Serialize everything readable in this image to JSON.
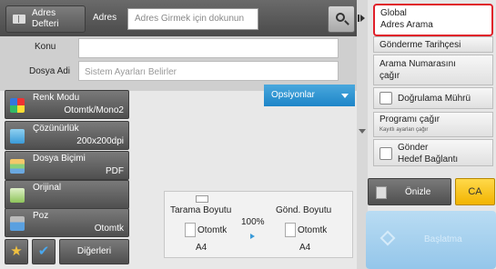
{
  "topbar": {
    "address_book_label": "Adres\nDefteri",
    "address_label": "Adres",
    "address_placeholder": "Adres Girmek için dokunun"
  },
  "form": {
    "subject_label": "Konu",
    "subject_value": "",
    "filename_label": "Dosya Adi",
    "filename_placeholder": "Sistem Ayarları Belirler",
    "options_label": "Opsiyonlar"
  },
  "settings": [
    {
      "title": "Renk Modu",
      "value": "Otomtk/Mono2",
      "icon": "color-mode-icon"
    },
    {
      "title": "Çözünürlük",
      "value": "200x200dpi",
      "icon": "resolution-icon"
    },
    {
      "title": "Dosya Biçimi",
      "value": "PDF",
      "icon": "file-format-icon"
    },
    {
      "title": "Orijinal",
      "value": "",
      "icon": "original-icon"
    },
    {
      "title": "Poz",
      "value": "Otomtk",
      "icon": "exposure-icon"
    }
  ],
  "bottom": {
    "others_label": "Diğerleri"
  },
  "preview": {
    "scan_size_label": "Tarama Boyutu",
    "send_size_label": "Gönd. Boyutu",
    "scan_mode": "Otomtk",
    "scan_paper": "A4",
    "ratio": "100%",
    "send_mode": "Otomtk",
    "send_paper": "A4"
  },
  "right_panel": {
    "global_search_label": "Global\nAdres Arama",
    "send_time_label": "Gönderme Tarihçesi",
    "call_number_label": "Arama Numarasını\nçağır",
    "verify_stamp_label": "Doğrulama Mührü",
    "call_program_label": "Programı çağır",
    "call_program_sub": "Kayıtlı ayarları çağır",
    "send_link_label": "Gönder\nHedef Bağlantı",
    "preview_label": "Önizle",
    "ca_label": "CA",
    "start_label": "Başlatma"
  },
  "colors": {
    "accent_blue": "#1d85c8",
    "ca_yellow": "#f2b400",
    "highlight_red": "#e0202a"
  }
}
